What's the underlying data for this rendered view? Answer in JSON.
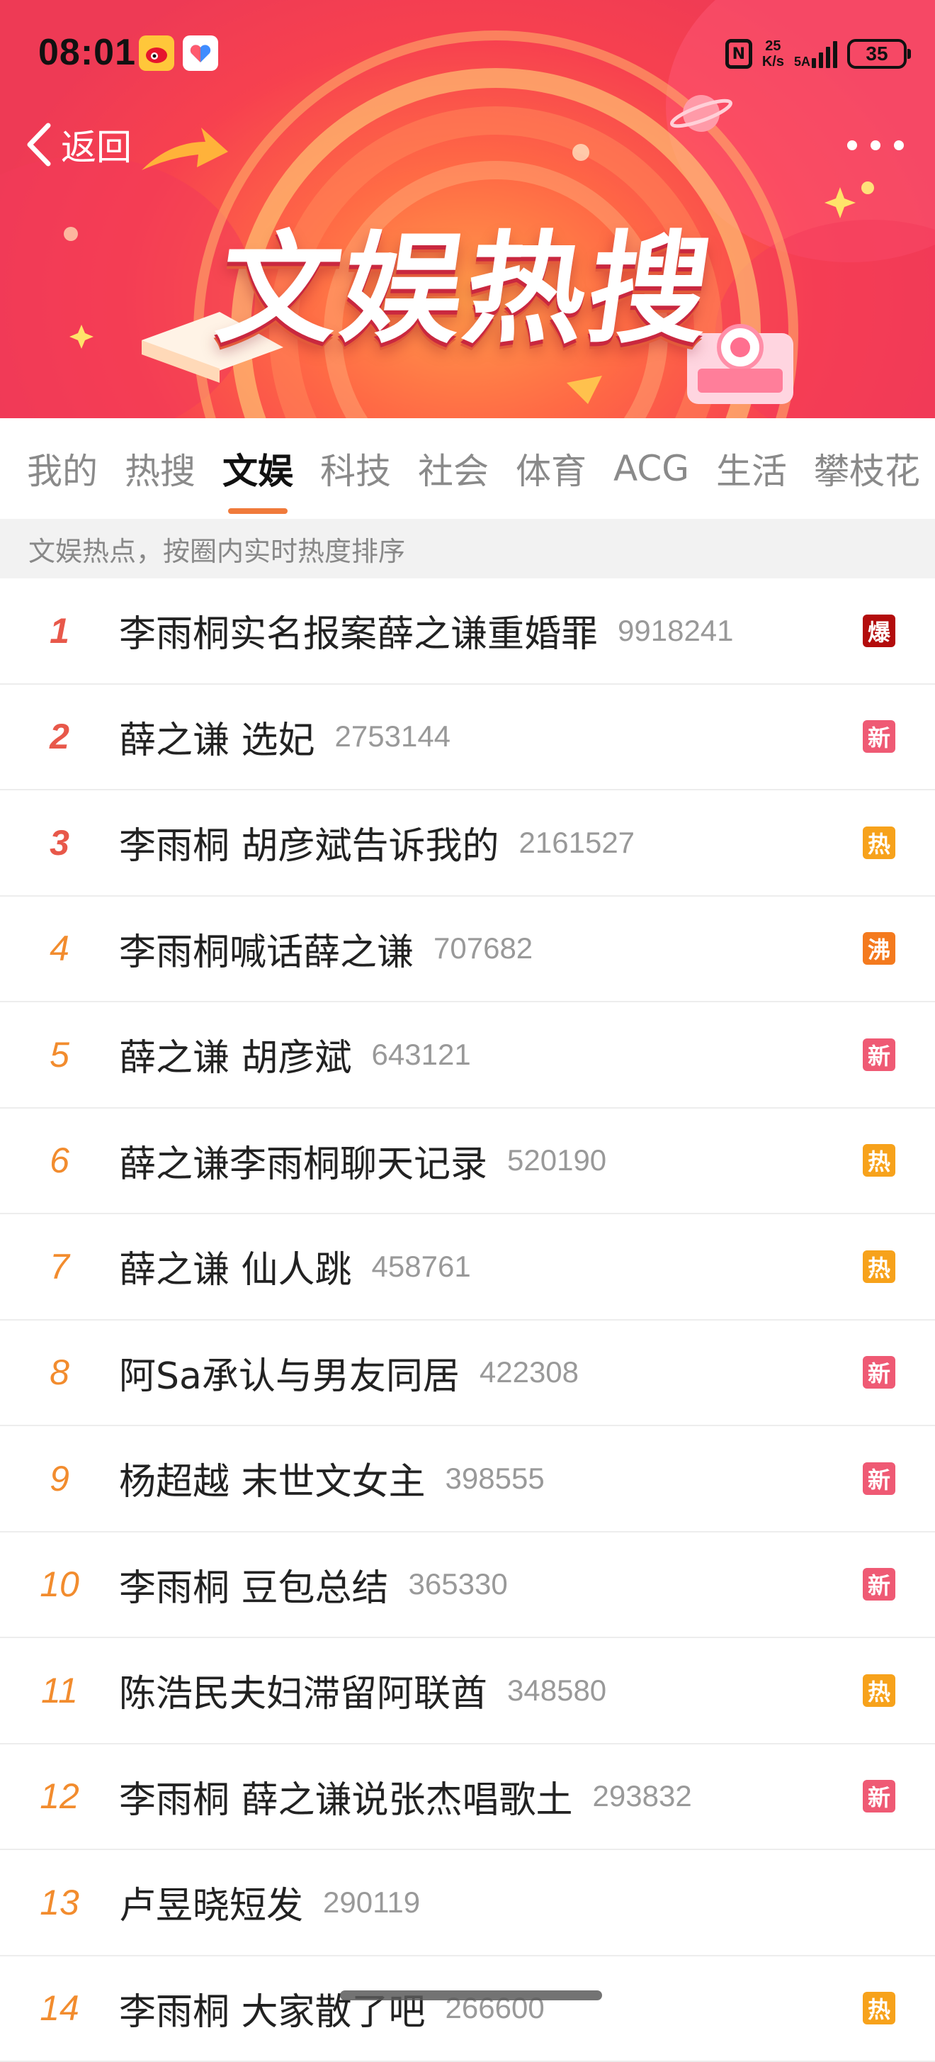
{
  "status_bar": {
    "time": "08:01",
    "net_speed_value": "25",
    "net_speed_unit": "K/s",
    "signal_label": "5A",
    "battery": "35"
  },
  "header": {
    "back_label": "返回",
    "banner_title": "文娱热搜"
  },
  "tabs": [
    {
      "label": "我的",
      "active": false
    },
    {
      "label": "热搜",
      "active": false
    },
    {
      "label": "文娱",
      "active": true
    },
    {
      "label": "科技",
      "active": false
    },
    {
      "label": "社会",
      "active": false
    },
    {
      "label": "体育",
      "active": false
    },
    {
      "label": "ACG",
      "active": false
    },
    {
      "label": "生活",
      "active": false
    },
    {
      "label": "攀枝花",
      "active": false
    }
  ],
  "subheader": "文娱热点，按圈内实时热度排序",
  "badge_colors": {
    "爆": "#b30c0c",
    "新": "#ef5a74",
    "热": "#f7a21b",
    "沸": "#f47a1e"
  },
  "items": [
    {
      "rank": "1",
      "title": "李雨桐实名报案薛之谦重婚罪",
      "count": "9918241",
      "badge": "爆"
    },
    {
      "rank": "2",
      "title": "薛之谦 选妃",
      "count": "2753144",
      "badge": "新"
    },
    {
      "rank": "3",
      "title": "李雨桐 胡彦斌告诉我的",
      "count": "2161527",
      "badge": "热"
    },
    {
      "rank": "4",
      "title": "李雨桐喊话薛之谦",
      "count": "707682",
      "badge": "沸"
    },
    {
      "rank": "5",
      "title": "薛之谦 胡彦斌",
      "count": "643121",
      "badge": "新"
    },
    {
      "rank": "6",
      "title": "薛之谦李雨桐聊天记录",
      "count": "520190",
      "badge": "热"
    },
    {
      "rank": "7",
      "title": "薛之谦 仙人跳",
      "count": "458761",
      "badge": "热"
    },
    {
      "rank": "8",
      "title": "阿Sa承认与男友同居",
      "count": "422308",
      "badge": "新"
    },
    {
      "rank": "9",
      "title": "杨超越 末世文女主",
      "count": "398555",
      "badge": "新"
    },
    {
      "rank": "10",
      "title": "李雨桐 豆包总结",
      "count": "365330",
      "badge": "新"
    },
    {
      "rank": "11",
      "title": "陈浩民夫妇滞留阿联酋",
      "count": "348580",
      "badge": "热"
    },
    {
      "rank": "12",
      "title": "李雨桐 薛之谦说张杰唱歌土",
      "count": "293832",
      "badge": "新"
    },
    {
      "rank": "13",
      "title": "卢昱晓短发",
      "count": "290119",
      "badge": ""
    },
    {
      "rank": "14",
      "title": "李雨桐 大家散了吧",
      "count": "266600",
      "badge": "热"
    }
  ]
}
